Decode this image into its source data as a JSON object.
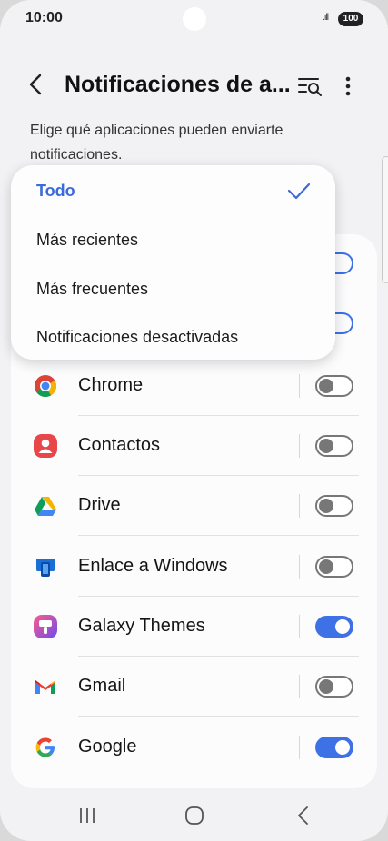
{
  "status": {
    "time": "10:00",
    "signal": ".ıll",
    "battery": "100"
  },
  "header": {
    "title": "Notificaciones de a..."
  },
  "description": "Elige qué aplicaciones pueden enviarte notificaciones.",
  "dropdown": {
    "items": [
      {
        "label": "Todo",
        "selected": true
      },
      {
        "label": "Más recientes",
        "selected": false
      },
      {
        "label": "Más frecuentes",
        "selected": false
      },
      {
        "label": "Notificaciones desactivadas",
        "selected": false
      }
    ]
  },
  "apps": [
    {
      "name": "Chrome",
      "enabled": false,
      "icon": "chrome-icon"
    },
    {
      "name": "Contactos",
      "enabled": false,
      "icon": "contacts-icon"
    },
    {
      "name": "Drive",
      "enabled": false,
      "icon": "drive-icon"
    },
    {
      "name": "Enlace a Windows",
      "enabled": false,
      "icon": "link-to-windows-icon"
    },
    {
      "name": "Galaxy Themes",
      "enabled": true,
      "icon": "galaxy-themes-icon"
    },
    {
      "name": "Gmail",
      "enabled": false,
      "icon": "gmail-icon"
    },
    {
      "name": "Google",
      "enabled": true,
      "icon": "google-icon"
    }
  ],
  "colors": {
    "accent": "#3e70e6",
    "menu_selected": "#3b6bd8",
    "toggle_off": "#777777"
  }
}
